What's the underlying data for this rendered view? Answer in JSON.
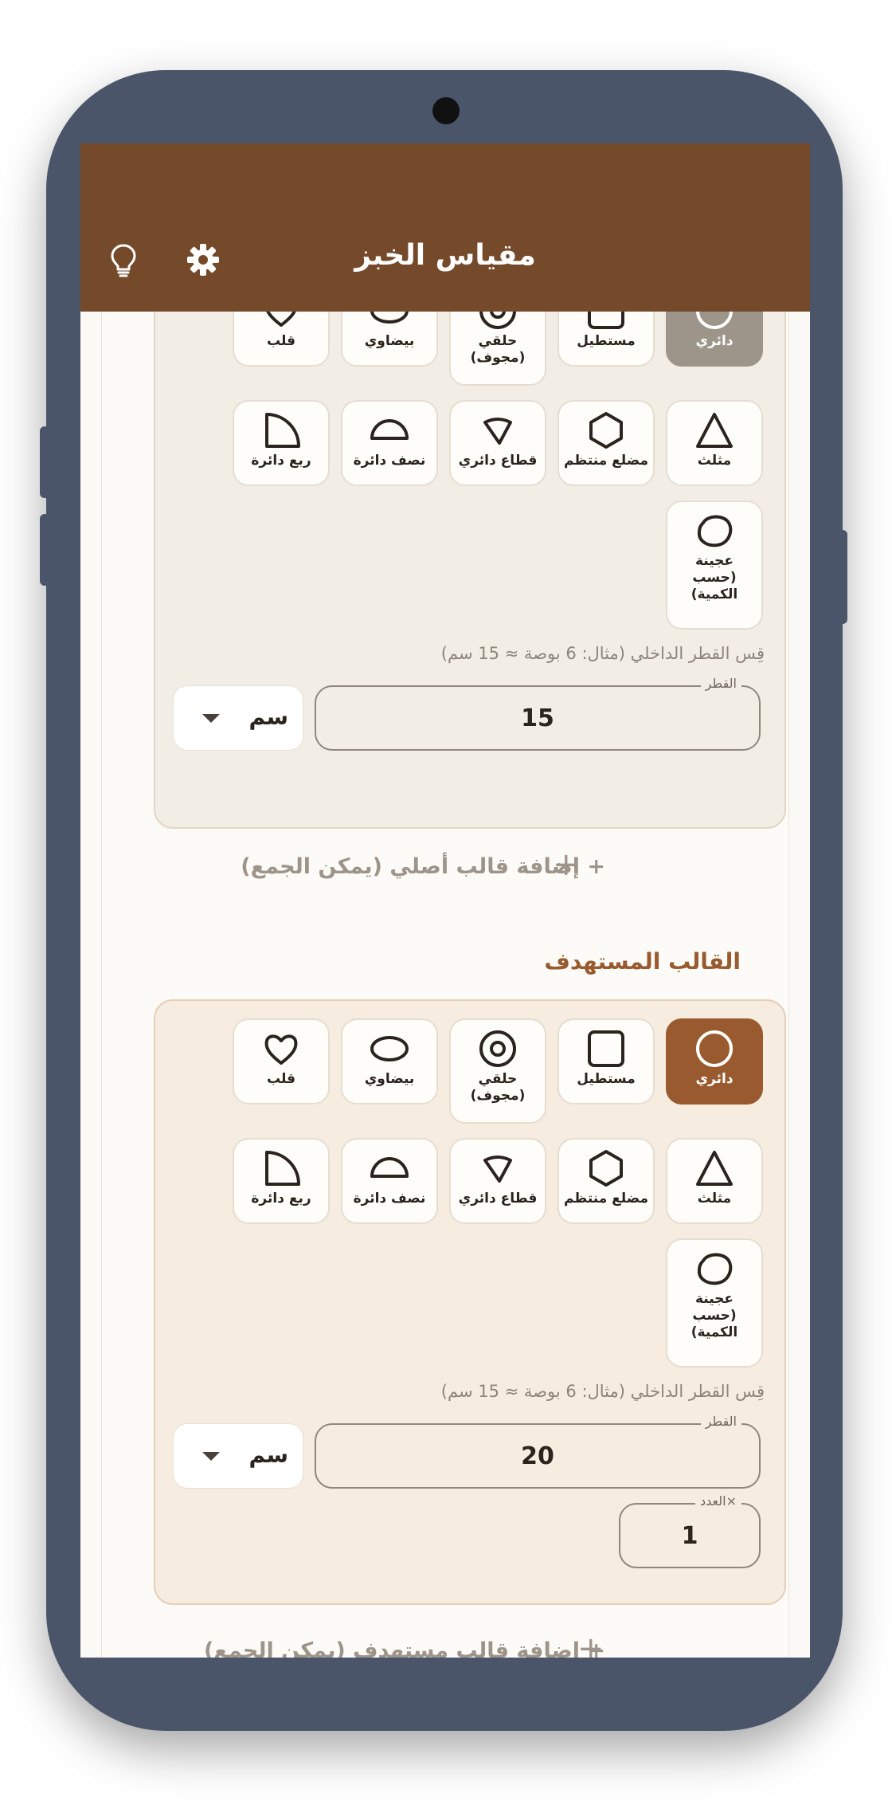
{
  "app": {
    "title": "مقياس الخبز"
  },
  "colors": {
    "primary": "#754a2b",
    "accent": "#985a2e",
    "selected_original": "#9e958a"
  },
  "shapes": [
    {
      "label": "دائري",
      "icon": "circle-icon"
    },
    {
      "label": "مستطيل",
      "icon": "square-icon"
    },
    {
      "label": "حلقي (مجوف)",
      "icon": "ring-icon"
    },
    {
      "label": "بيضاوي",
      "icon": "ellipse-icon"
    },
    {
      "label": "قلب",
      "icon": "heart-icon"
    },
    {
      "label": "مثلث",
      "icon": "triangle-icon"
    },
    {
      "label": "مضلع منتظم",
      "icon": "hexagon-icon"
    },
    {
      "label": "قطاع دائري",
      "icon": "sector-icon"
    },
    {
      "label": "نصف دائرة",
      "icon": "semicircle-icon"
    },
    {
      "label": "ربع دائرة",
      "icon": "quarter-circle-icon"
    },
    {
      "label": "عجينة (حسب الكمية)",
      "icon": "dough-icon"
    }
  ],
  "original": {
    "selected_shape": "دائري",
    "hint": "قِس القطر الداخلي (مثال: 6 بوصة ≈ 15 سم)",
    "diameter_label": "القطر",
    "diameter_value": "15",
    "unit": "سم",
    "add_label": "+ إضافة قالب أصلي (يمكن الجمع)"
  },
  "target": {
    "section_title": "القالب المستهدف",
    "selected_shape": "دائري",
    "hint": "قِس القطر الداخلي (مثال: 6 بوصة ≈ 15 سم)",
    "diameter_label": "القطر",
    "diameter_value": "20",
    "unit": "سم",
    "count_label": "×العدد",
    "count_value": "1",
    "add_label": "+ إضافة قالب مستهدف (يمكن الجمع)"
  }
}
